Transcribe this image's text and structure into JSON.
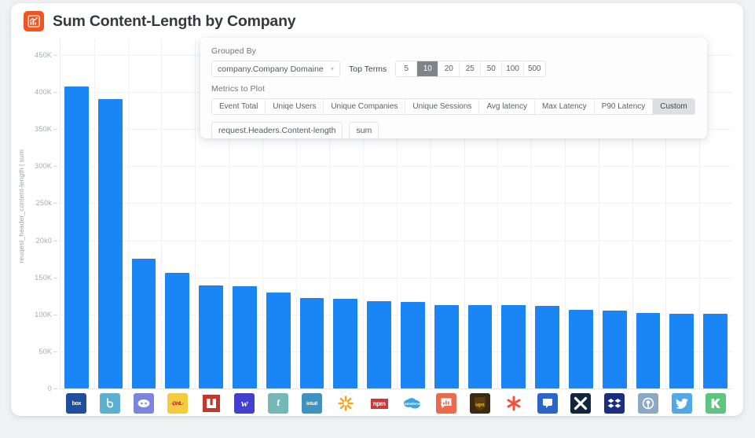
{
  "header": {
    "title": "Sum Content-Length by Company",
    "icon": "bar-chart-icon",
    "icon_color": "#f4541d"
  },
  "panel": {
    "grouped_by_label": "Grouped By",
    "group_field": "company.Company Domaine",
    "top_terms_label": "Top Terms",
    "top_terms_options": [
      "5",
      "10",
      "20",
      "25",
      "50",
      "100",
      "500"
    ],
    "top_terms_selected": "10",
    "metrics_label": "Metrics to Plot",
    "metrics_options": [
      "Event Total",
      "Uniqe Users",
      "Unique Companies",
      "Unique Sessions",
      "Avg latency",
      "Max Latency",
      "P90 Latency",
      "Custom"
    ],
    "metrics_selected": "Custom",
    "custom_field": "request.Headers.Content-length",
    "custom_aggregation": "sum"
  },
  "chart_data": {
    "type": "bar",
    "title": "Sum Content-Length by Company",
    "xlabel": "",
    "ylabel": "reuqest_header_content-length | sum",
    "ylim": [
      0,
      450000
    ],
    "grid": true,
    "legend": "none",
    "bar_color": "#1a85f5",
    "ytick_labels": [
      "450K",
      "400K",
      "350K",
      "300K",
      "250k",
      "20k0",
      "150K",
      "100K",
      "50K",
      "0"
    ],
    "ytick_values": [
      450000,
      400000,
      350000,
      300000,
      250000,
      200000,
      150000,
      100000,
      50000,
      0
    ],
    "categories": [
      "box",
      "b",
      "discord",
      "dhl",
      "n",
      "w",
      "t",
      "intuit",
      "walmart",
      "npm",
      "salesforce",
      "chart",
      "ups",
      "asterisk",
      "blue-square",
      "x",
      "dropbox",
      "pin",
      "twitter",
      "kickstarter"
    ],
    "values": [
      408000,
      391000,
      175000,
      156000,
      139000,
      138000,
      129000,
      122000,
      121000,
      118000,
      117000,
      113000,
      113000,
      112000,
      111000,
      106000,
      105000,
      102000,
      101000,
      101000
    ]
  }
}
